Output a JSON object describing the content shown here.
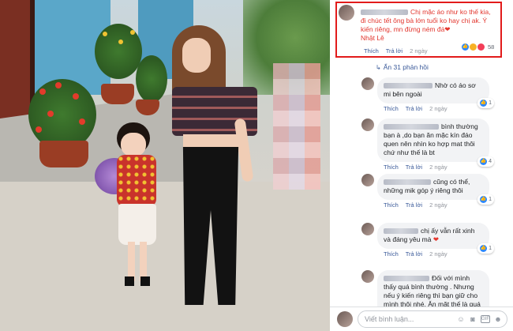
{
  "main_comment": {
    "text": "Chị mặc áo như ko thế kia, đi chúc tết ông bà lớn tuổi ko hay chị ak. Ý kiến riêng, mn đừng ném đá",
    "tail": "Nhật Lê",
    "actions": {
      "like": "Thích",
      "reply": "Trả lời",
      "time": "2 ngày"
    },
    "reaction_count": "58"
  },
  "more_replies": "Ẩn 31 phản hồi",
  "replies": [
    {
      "text": "Nhờ có áo sơ mi bên ngoài",
      "like": "Thích",
      "reply": "Trả lời",
      "time": "2 ngày",
      "reaction_count": "1"
    },
    {
      "text": "bình thường bạn à ,do bạn ăn mặc kín đáo quen nên nhìn ko hợp mat thôi chứ như thế là bt",
      "like": "Thích",
      "reply": "Trả lời",
      "time": "2 ngày",
      "reaction_count": "4"
    },
    {
      "text": "cũng có thể, những mik góp ý riêng thôi",
      "like": "Thích",
      "reply": "Trả lời",
      "time": "2 ngày",
      "reaction_count": "1"
    },
    {
      "text": "chị ấy vẫn rất xinh và đáng yêu mà",
      "like": "Thích",
      "reply": "Trả lời",
      "time": "2 ngày",
      "reaction_count": "1"
    },
    {
      "text": "Đối với mình thấy quá bình thường . Nhưng nếu ý kiến riêng thì bạn giữ cho mình thôi nhé. Ăn mặt thế là quá bình thường r",
      "like": "",
      "reply": "",
      "time": "",
      "reaction_count": ""
    }
  ],
  "write_comment": {
    "placeholder": "Viết bình luận..."
  },
  "icons": [
    "like-icon",
    "haha-icon",
    "heart-icon",
    "emoji-icon",
    "camera-icon",
    "gif-icon",
    "sticker-icon",
    "chevron-down-icon"
  ],
  "colors": {
    "highlight_border": "#e21b1b",
    "main_comment_text": "#e2352d",
    "link": "#385898"
  }
}
